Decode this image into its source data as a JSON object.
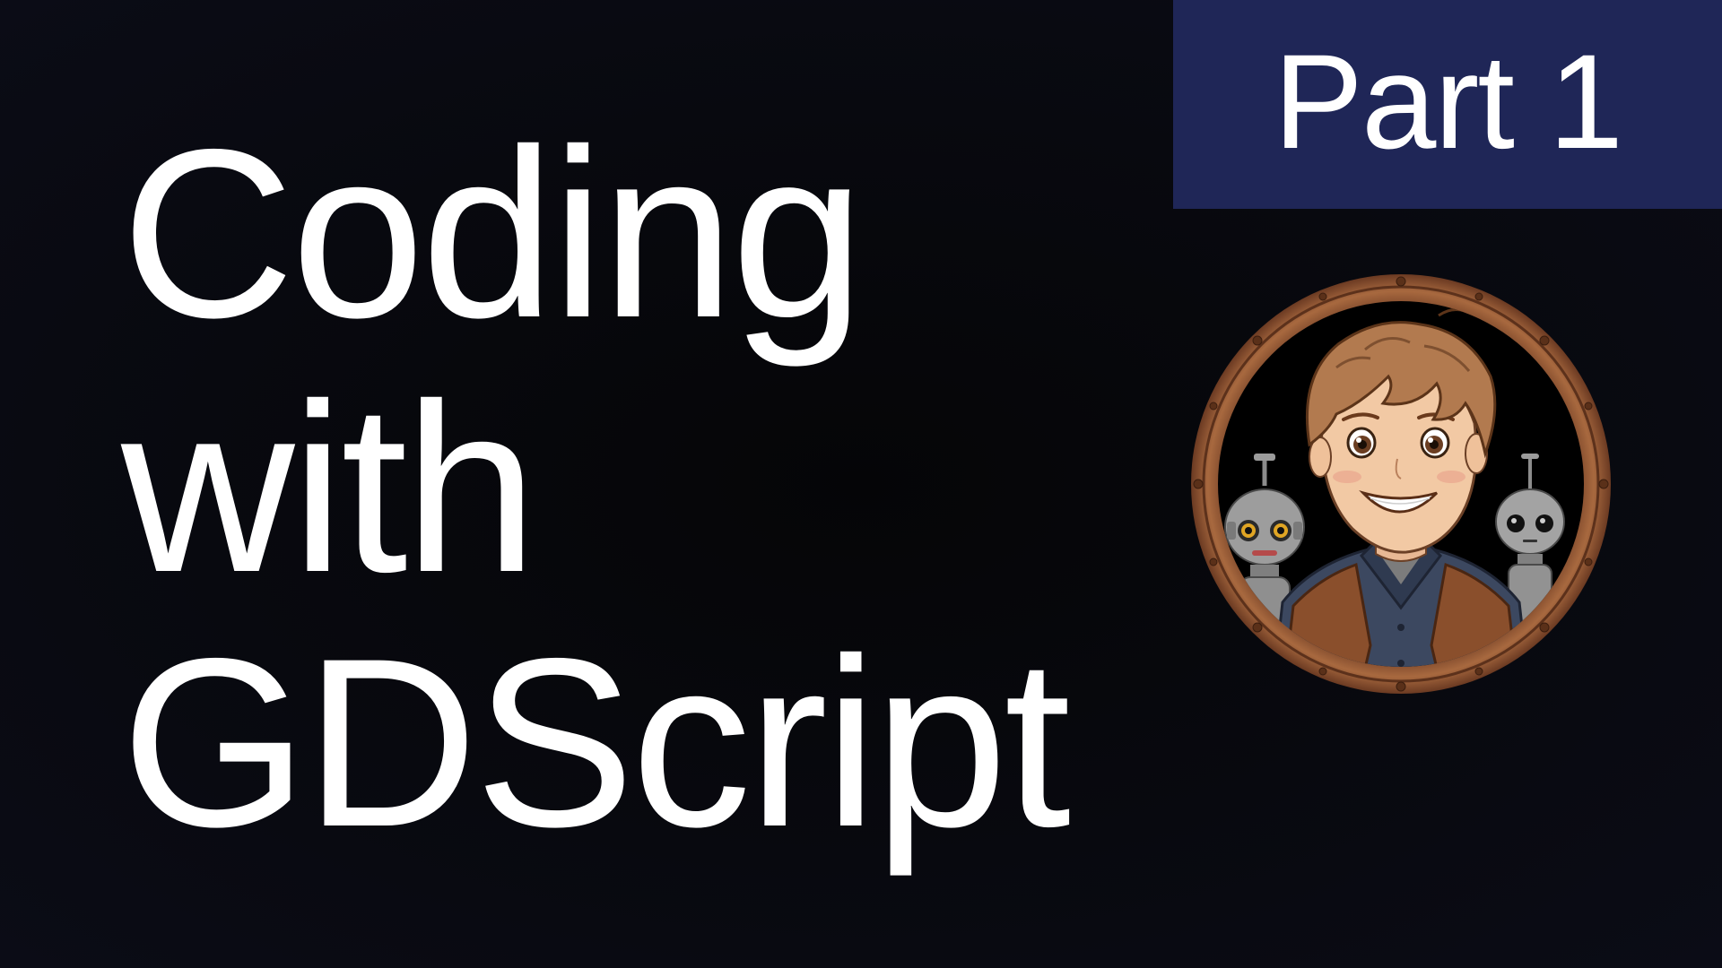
{
  "title": {
    "line1": "Coding",
    "line2": "with",
    "line3": "GDScript"
  },
  "badge": {
    "label": "Part 1",
    "color": "#1f2657"
  },
  "avatar": {
    "icon": "character-porthole-illustration",
    "ring_color": "#9a5f3d"
  }
}
